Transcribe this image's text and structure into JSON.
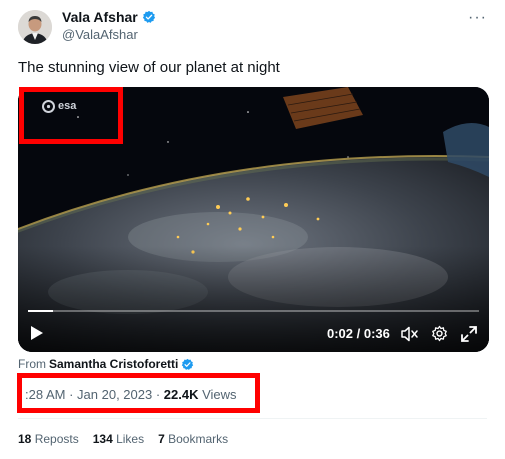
{
  "author": {
    "display_name": "Vala Afshar",
    "handle": "@ValaAfshar",
    "verified": true,
    "verified_color": "#1d9bf0",
    "more_icon": "more-horizontal-icon",
    "more_glyph": "···"
  },
  "tweet": {
    "text": "The stunning view of our planet at night"
  },
  "video": {
    "watermark": "esa",
    "current_time": "0:02",
    "separator": " / ",
    "duration": "0:36",
    "progress": 0.056,
    "icons": [
      "play-icon",
      "mute-icon",
      "settings-icon",
      "fullscreen-icon"
    ]
  },
  "attribution": {
    "prefix": "From",
    "source_name": "Samantha Cristoforetti"
  },
  "meta": {
    "time": ":28 AM",
    "dot1": " · ",
    "date": "Jan 20, 2023",
    "dot2": " · ",
    "views_count": "22.4K",
    "views_label": " Views"
  },
  "stats": {
    "reposts_count": "18",
    "reposts_label": " Reposts",
    "likes_count": "134",
    "likes_label": " Likes",
    "bookmarks_count": "7",
    "bookmarks_label": " Bookmarks"
  },
  "colors": {
    "annotation": "#ff0000",
    "text_secondary": "#536471",
    "text_primary": "#0f1419"
  }
}
